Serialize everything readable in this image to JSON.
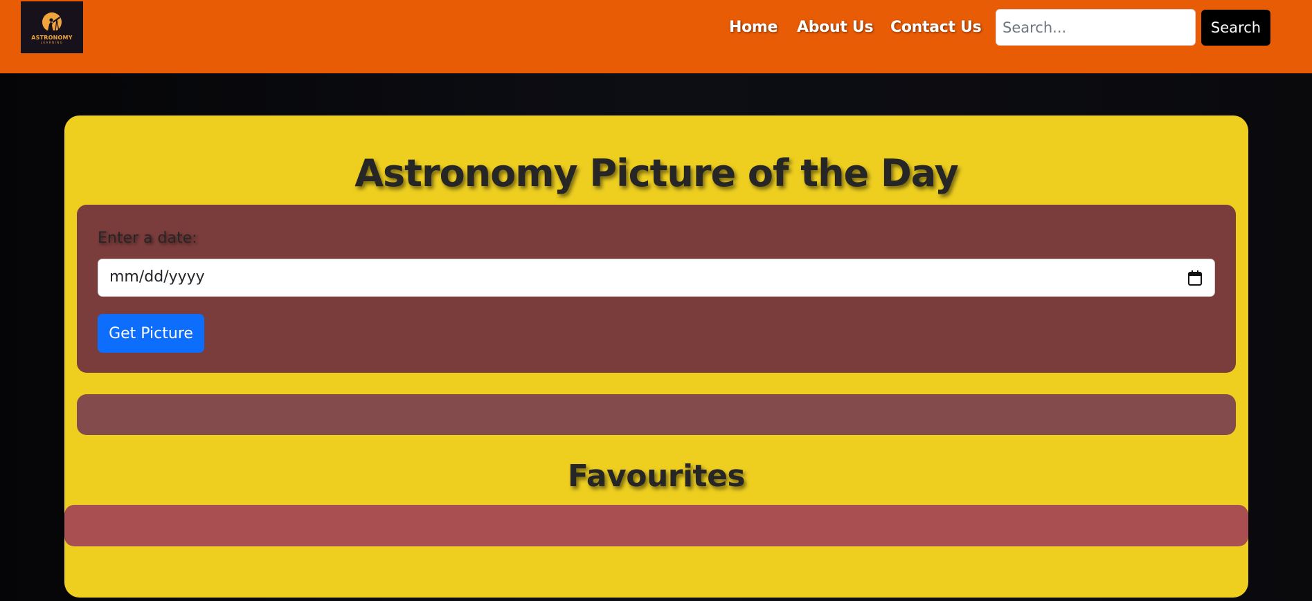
{
  "header": {
    "logo": {
      "title": "ASTRONOMY",
      "subtitle": "LEARNING"
    },
    "nav": [
      {
        "label": "Home"
      },
      {
        "label": "About Us"
      },
      {
        "label": "Contact Us"
      }
    ],
    "search": {
      "placeholder": "Search...",
      "value": "",
      "button_label": "Search"
    }
  },
  "main": {
    "title": "Astronomy Picture of the Day",
    "date_form": {
      "label": "Enter a date:",
      "placeholder": "mm/dd/yyyy",
      "button_label": "Get Picture"
    },
    "favourites_title": "Favourites"
  },
  "colors": {
    "navbar": "#e95c06",
    "card": "#eecf20",
    "date_panel": "#7b3c3c",
    "result_panel": "#834b4b",
    "favourites_panel": "#a94f51",
    "primary_button": "#0d6efd",
    "search_button": "#000000"
  },
  "icons": {
    "logo": "astronomer-telescope-icon",
    "date_picker": "calendar-icon"
  }
}
